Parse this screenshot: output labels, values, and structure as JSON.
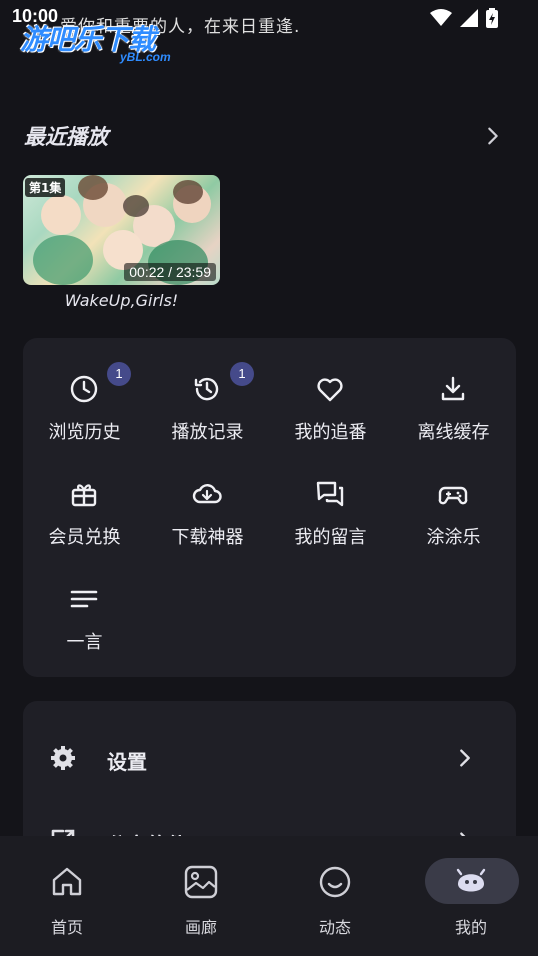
{
  "status_bar": {
    "time": "10:00",
    "quote": "爱你和重要的人，在来日重逢."
  },
  "watermark": {
    "main": "游吧乐下载",
    "sub": "yBL.com"
  },
  "recent": {
    "title": "最近播放",
    "items": [
      {
        "episode": "第1集",
        "progress": "00:22 / 23:59",
        "title": "WakeUp,Girls!"
      }
    ]
  },
  "grid": {
    "items": [
      {
        "label": "浏览历史",
        "icon": "clock-icon",
        "badge": "1"
      },
      {
        "label": "播放记录",
        "icon": "history-icon",
        "badge": "1"
      },
      {
        "label": "我的追番",
        "icon": "heart-icon",
        "badge": ""
      },
      {
        "label": "离线缓存",
        "icon": "download-icon",
        "badge": ""
      },
      {
        "label": "会员兑换",
        "icon": "gift-icon",
        "badge": ""
      },
      {
        "label": "下载神器",
        "icon": "cloud-download-icon",
        "badge": ""
      },
      {
        "label": "我的留言",
        "icon": "chat-icon",
        "badge": ""
      },
      {
        "label": "涂涂乐",
        "icon": "gamepad-icon",
        "badge": ""
      },
      {
        "label": "一言",
        "icon": "lines-icon",
        "badge": ""
      }
    ]
  },
  "settings": {
    "items": [
      {
        "label": "设置",
        "icon": "gear-icon"
      },
      {
        "label": "分享软件",
        "icon": "share-icon"
      }
    ]
  },
  "bottom_nav": {
    "items": [
      {
        "label": "首页",
        "icon": "home-icon"
      },
      {
        "label": "画廊",
        "icon": "gallery-icon"
      },
      {
        "label": "动态",
        "icon": "smile-icon"
      },
      {
        "label": "我的",
        "icon": "ghost-icon",
        "active": true
      }
    ]
  },
  "colors": {
    "background": "#141419",
    "card": "#1f1f26",
    "badge": "#454a8a",
    "nav_active_pill": "#3a3b48"
  }
}
